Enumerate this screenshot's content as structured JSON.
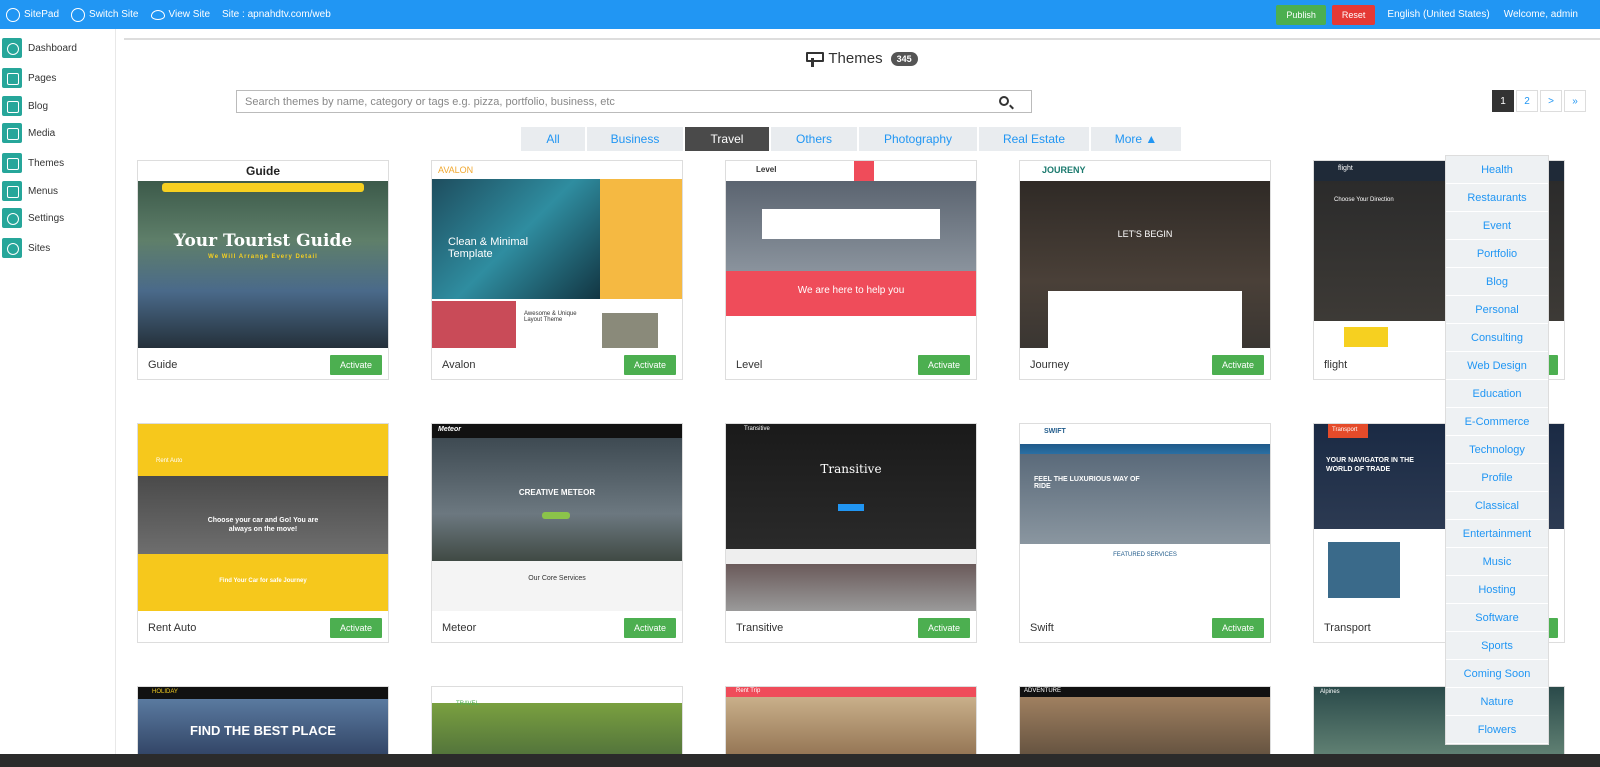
{
  "topbar": {
    "brand": "SitePad",
    "switch_site": "Switch Site",
    "view_site": "View Site",
    "site_label": "Site : apnahdtv.com/web",
    "publish": "Publish",
    "reset": "Reset",
    "language": "English (United States)",
    "welcome": "Welcome, admin"
  },
  "sidebar": {
    "items": [
      {
        "label": "Dashboard",
        "icon": "dashboard-icon"
      },
      {
        "label": "Pages",
        "icon": "pages-icon"
      },
      {
        "label": "Blog",
        "icon": "blog-icon"
      },
      {
        "label": "Media",
        "icon": "media-icon"
      },
      {
        "label": "Themes",
        "icon": "paint-roller-icon"
      },
      {
        "label": "Menus",
        "icon": "menus-icon"
      },
      {
        "label": "Settings",
        "icon": "gear-icon"
      },
      {
        "label": "Sites",
        "icon": "globe-icon"
      }
    ]
  },
  "heading": {
    "title": "Themes",
    "count": "345"
  },
  "search": {
    "placeholder": "Search themes by name, category or tags e.g. pizza, portfolio, business, etc"
  },
  "pagination": [
    "1",
    "2",
    ">",
    "»"
  ],
  "tabs": [
    "All",
    "Business",
    "Travel",
    "Others",
    "Photography",
    "Real Estate",
    "More ▲"
  ],
  "active_tab": "Travel",
  "activate_label": "Activate",
  "themes": [
    {
      "name": "Guide",
      "thumb_text": "Your Tourist Guide",
      "thumb_sub": "We Will Arrange Every Detail",
      "logo": "Guide"
    },
    {
      "name": "Avalon",
      "thumb_text": "Clean & Minimal Template",
      "thumb_sub": "Awesome & Unique Layout Theme",
      "logo": "AVALON"
    },
    {
      "name": "Level",
      "thumb_text": "We are here to help you",
      "thumb_sub": "",
      "logo": "Level"
    },
    {
      "name": "Journey",
      "thumb_text": "LET'S BEGIN",
      "thumb_sub": "",
      "logo": "JOURENY"
    },
    {
      "name": "flight",
      "thumb_text": "Choose Your Direction",
      "thumb_sub": "",
      "logo": "flight"
    },
    {
      "name": "Rent Auto",
      "thumb_text": "Choose your car and Go! You are always on the move!",
      "thumb_sub": "Find Your Car for safe Journey",
      "logo": "Rent Auto"
    },
    {
      "name": "Meteor",
      "thumb_text": "CREATIVE METEOR",
      "thumb_sub": "Our Core Services",
      "logo": "Meteor"
    },
    {
      "name": "Transitive",
      "thumb_text": "Transitive",
      "thumb_sub": "",
      "logo": "Transitive"
    },
    {
      "name": "Swift",
      "thumb_text": "FEEL THE LUXURIOUS WAY OF RIDE",
      "thumb_sub": "FEATURED SERVICES",
      "logo": "SWIFT"
    },
    {
      "name": "Transport",
      "thumb_text": "YOUR NAVIGATOR IN THE WORLD OF TRADE",
      "thumb_sub": "",
      "logo": "Transport"
    },
    {
      "name": "",
      "thumb_text": "FIND THE BEST PLACE",
      "thumb_sub": "",
      "logo": "HOLIDAY"
    },
    {
      "name": "",
      "thumb_text": "",
      "thumb_sub": "",
      "logo": "TRAVEL"
    },
    {
      "name": "",
      "thumb_text": "",
      "thumb_sub": "",
      "logo": "Rent Trip"
    },
    {
      "name": "",
      "thumb_text": "",
      "thumb_sub": "",
      "logo": "ADVENTURE"
    },
    {
      "name": "",
      "thumb_text": "",
      "thumb_sub": "",
      "logo": "Alpines"
    }
  ],
  "more_menu": [
    "Health",
    "Restaurants",
    "Event",
    "Portfolio",
    "Blog",
    "Personal",
    "Consulting",
    "Web Design",
    "Education",
    "E-Commerce",
    "Technology",
    "Profile",
    "Classical",
    "Entertainment",
    "Music",
    "Hosting",
    "Software",
    "Sports",
    "Coming Soon",
    "Nature",
    "Flowers"
  ],
  "colors": {
    "topbar": "#2196f3",
    "accent": "#26a69a",
    "activate": "#4caf50",
    "reset": "#e53935"
  }
}
